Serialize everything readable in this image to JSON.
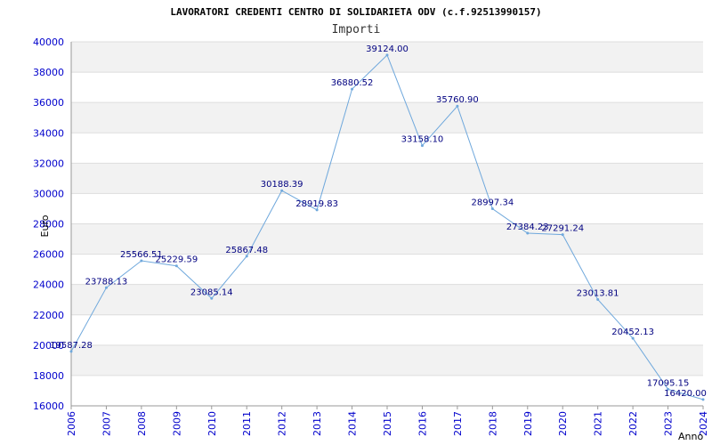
{
  "chart_data": {
    "type": "line",
    "title": "LAVORATORI CREDENTI CENTRO DI SOLIDARIETA ODV (c.f.92513990157)",
    "subtitle": "Importi",
    "xlabel": "Anno",
    "ylabel": "Euro",
    "ylim": [
      16000,
      40000
    ],
    "y_ticks": [
      16000,
      18000,
      20000,
      22000,
      24000,
      26000,
      28000,
      30000,
      32000,
      34000,
      36000,
      38000,
      40000
    ],
    "categories": [
      "2006",
      "2007",
      "2008",
      "2009",
      "2010",
      "2011",
      "2012",
      "2013",
      "2014",
      "2015",
      "2016",
      "2017",
      "2018",
      "2019",
      "2020",
      "2021",
      "2022",
      "2023",
      "2024"
    ],
    "values": [
      19587.28,
      23788.13,
      25566.51,
      25229.59,
      23085.14,
      25867.48,
      30188.39,
      28919.83,
      36880.52,
      39124.0,
      33158.1,
      35760.9,
      28997.34,
      27384.23,
      27291.24,
      23013.81,
      20452.13,
      17095.15,
      16420.0
    ],
    "value_labels": [
      "19587.28",
      "23788.13",
      "25566.51",
      "25229.59",
      "23085.14",
      "25867.48",
      "30188.39",
      "28919.83",
      "36880.52",
      "39124.00",
      "33158.10",
      "35760.90",
      "28997.34",
      "27384.23",
      "27291.24",
      "23013.81",
      "20452.13",
      "17095.15",
      "16420.00"
    ],
    "grid": true,
    "band_colors": [
      "#ffffff",
      "#f2f2f2"
    ],
    "line_color": "#6fa8dc",
    "tick_color": "#0000cc",
    "label_color": "#000080"
  }
}
